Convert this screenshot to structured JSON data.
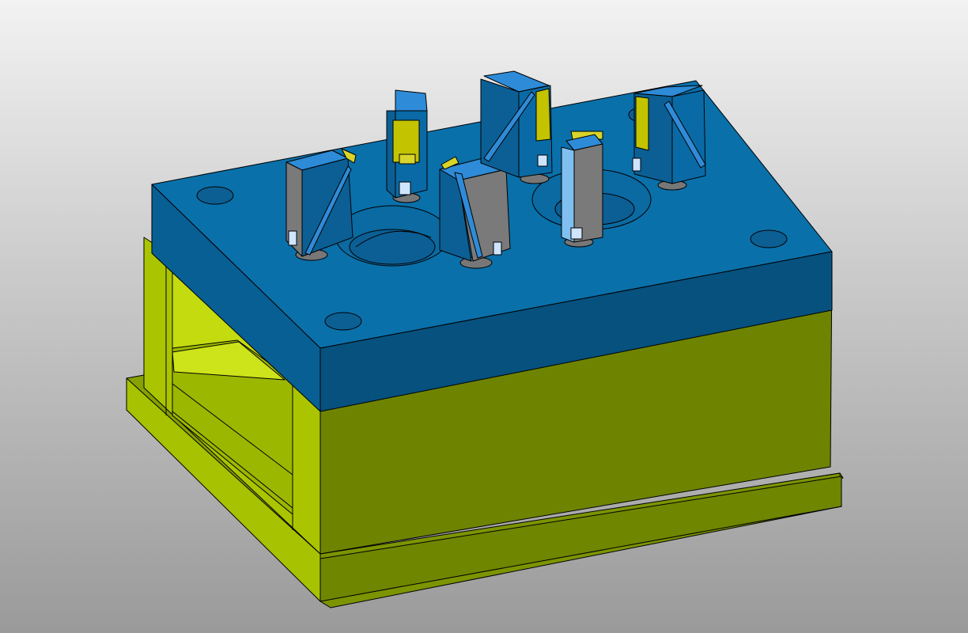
{
  "viewport": {
    "background_top": "#f2f2f2",
    "background_bottom": "#9a9a9a"
  },
  "model": {
    "parts": [
      {
        "name": "top-clamp-plate",
        "color_top": "#0a6ea6",
        "color_side": "#06507c"
      },
      {
        "name": "mold-base",
        "color_front": "#6e8400",
        "color_side": "#a9c400",
        "color_top": "#b4d000"
      },
      {
        "name": "slider-inserts",
        "count": 6,
        "color_light": "#2e8bd8",
        "color_dark": "#0b5f95",
        "color_core": "#7a7a7a",
        "color_wedge": "#d7d42b"
      }
    ],
    "edge_color": "#000000"
  }
}
